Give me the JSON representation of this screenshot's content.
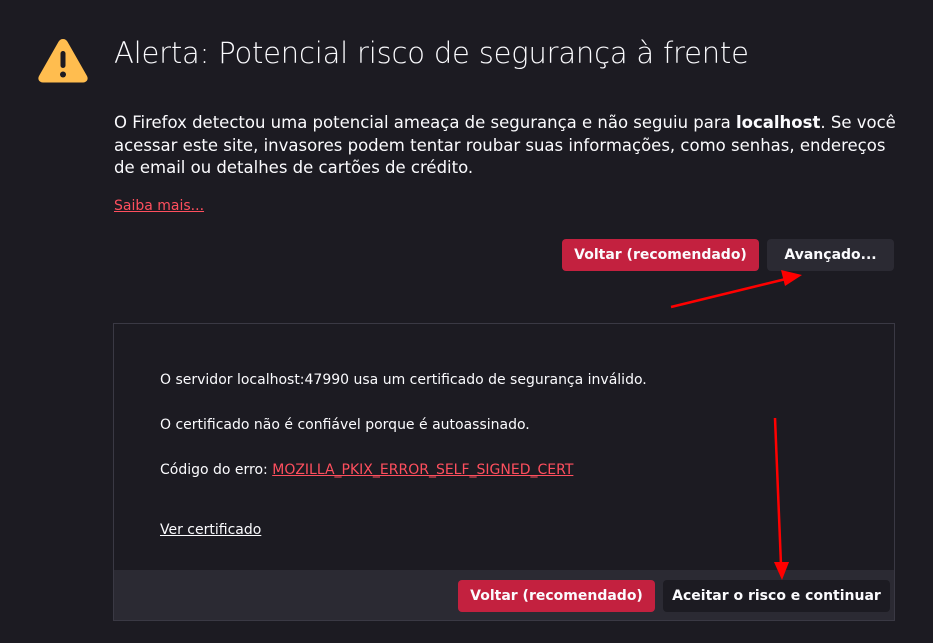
{
  "page": {
    "title": "Alerta: Potencial risco de segurança à frente",
    "description_pre": "O Firefox detectou uma potencial ameaça de segurança e não seguiu para ",
    "description_host": "localhost",
    "description_post": ". Se você acessar este site, invasores podem tentar roubar suas informações, como senhas, endereços de email ou detalhes de cartões de crédito.",
    "learn_more": "Saiba mais..."
  },
  "buttons": {
    "back_recommended": "Voltar (recomendado)",
    "advanced": "Avançado..."
  },
  "advanced": {
    "line1": "O servidor localhost:47990 usa um certificado de segurança inválido.",
    "line2": "O certificado não é confiável porque é autoassinado.",
    "error_label": "Código do erro: ",
    "error_code": "MOZILLA_PKIX_ERROR_SELF_SIGNED_CERT",
    "view_certificate": "Ver certificado",
    "back_recommended": "Voltar (recomendado)",
    "accept_risk": "Aceitar o risco e continuar"
  },
  "colors": {
    "background": "#1c1b22",
    "primary": "#c3213f",
    "link": "#ff4f5e",
    "warning": "#ffbd4f",
    "annotation_arrow": "#ff0000"
  },
  "icons": {
    "warning": "warning-triangle-icon"
  }
}
